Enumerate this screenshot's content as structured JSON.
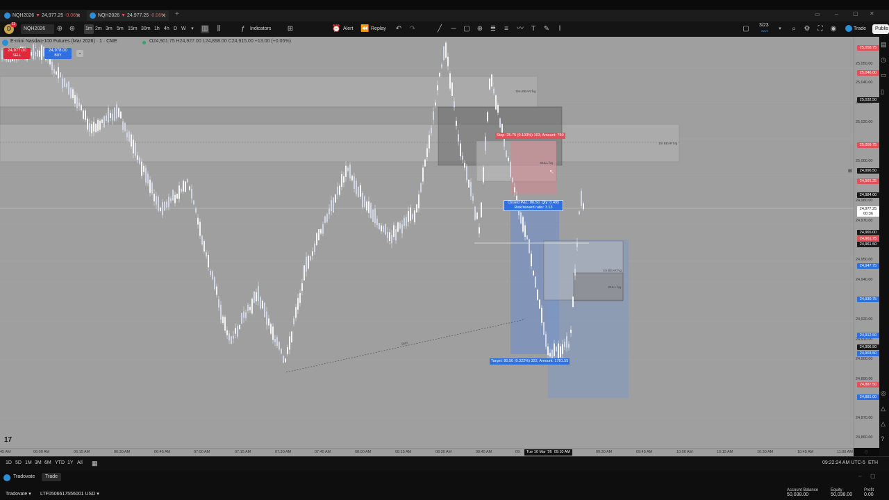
{
  "tabs": [
    {
      "symbol": "NQH2026",
      "direction": "▼",
      "price": "24,977.25",
      "change": "-0.06%"
    },
    {
      "symbol": "NQH2026",
      "direction": "▼",
      "price": "24,977.25",
      "change": "-0.06%"
    }
  ],
  "toolbar": {
    "symbol": "NQH2026",
    "intervals": [
      "1m",
      "2m",
      "3m",
      "5m",
      "15m",
      "30m",
      "1h",
      "4h",
      "D",
      "W"
    ],
    "active_interval": "1m",
    "indicators": "Indicators",
    "alert": "Alert",
    "replay": "Replay",
    "layout_count": "3/23",
    "layout_sub": "Save",
    "trade": "Trade",
    "publish": "Publis",
    "avatar_letter": "D",
    "badge": "11"
  },
  "legend": {
    "title": "E-mini Nasdaq-100 Futures (Mar 2026) · 1 · CME",
    "ohlc": "O24,901.75  H24,927.00  L24,898.00  C24,915.00  +13.00 (+0.05%)",
    "sell_price": "24,977.00",
    "sell_label": "SELL",
    "spread": "1",
    "buy_price": "24,978.00",
    "buy_label": "BUY"
  },
  "annotations": {
    "stop": "Stop: 25.75 (0.103%) 103, Amount: 750",
    "closed_pnl": "Closed P&L: 80.50, Qty: 0.495",
    "rr": "Risk/reward ratio: 3.13",
    "target": "Target: 80.50 (0.322%) 322, Amount: 1781.55",
    "zone1": "15m BEAR fvg",
    "zone2": "1hr BEAR fvg",
    "zone3": "BULL fvg",
    "zone4": "1m BEAR fvg",
    "zone5": "BULL fvg",
    "ssl": "SMT"
  },
  "price_axis": {
    "labels": [
      "25,050.00",
      "25,040.00",
      "25,030.00",
      "25,020.00",
      "25,000.00",
      "24,980.00",
      "24,970.00",
      "24,950.00",
      "24,940.00",
      "24,920.00",
      "24,910.00",
      "24,900.00",
      "24,890.00",
      "24,870.00",
      "24,860.00"
    ],
    "tags": [
      {
        "text": "25,058.75",
        "color": "#e0525a"
      },
      {
        "text": "25,046.00",
        "color": "#e0525a"
      },
      {
        "text": "25,032.50",
        "color": "#1a1a1a"
      },
      {
        "text": "25,009.75",
        "color": "#e0525a"
      },
      {
        "text": "24,996.50",
        "color": "#1a1a1a"
      },
      {
        "text": "24,991.25",
        "color": "#e0525a"
      },
      {
        "text": "24,984.00",
        "color": "#1a1a1a"
      },
      {
        "text": "24,977.25",
        "color": "#ffffff"
      },
      {
        "text": "00:36",
        "color": "#ffffff"
      },
      {
        "text": "24,965.00",
        "color": "#1a1a1a"
      },
      {
        "text": "24,961.75",
        "color": "#e0525a"
      },
      {
        "text": "24,961.50",
        "color": "#1a1a1a"
      },
      {
        "text": "24,947.75",
        "color": "#2f6fe0"
      },
      {
        "text": "24,930.75",
        "color": "#2f6fe0"
      },
      {
        "text": "24,912.50",
        "color": "#2f6fe0"
      },
      {
        "text": "24,906.50",
        "color": "#1a1a1a"
      },
      {
        "text": "24,903.50",
        "color": "#2f6fe0"
      },
      {
        "text": "24,887.50",
        "color": "#e0525a"
      },
      {
        "text": "24,881.00",
        "color": "#2f6fe0"
      }
    ]
  },
  "time_axis": {
    "labels": [
      "45 AM",
      "06:00 AM",
      "06:15 AM",
      "06:30 AM",
      "06:45 AM",
      "07:00 AM",
      "07:15 AM",
      "07:30 AM",
      "07:45 AM",
      "08:00 AM",
      "08:15 AM",
      "08:30 AM",
      "08:45 AM",
      "09:",
      "09:30 AM",
      "09:45 AM",
      "10:00 AM",
      "10:15 AM",
      "10:30 AM",
      "10:45 AM",
      "11:00 AM"
    ],
    "cursor_date": "Tue 10 Mar '26",
    "cursor_time": "09:10 AM"
  },
  "bottombar": {
    "ranges": [
      "1D",
      "5D",
      "1M",
      "3M",
      "6M",
      "YTD",
      "1Y",
      "All"
    ],
    "clock": "09:22:24 AM UTC-5",
    "session": "ETH"
  },
  "tradepanel": {
    "broker": "Tradovate",
    "tab": "Trade",
    "account_broker": "Tradovate",
    "account_id": "LTF0506617556001 USD",
    "balance_label": "Account Balance",
    "balance": "50,038.00",
    "equity_label": "Equity",
    "equity": "50,038.00",
    "profit_label": "Profit",
    "profit": "0.00"
  },
  "colors": {
    "bg_chart": "#9f9f9f",
    "sell": "#e0283a",
    "buy": "#2f6fe0",
    "stop_zone": "#d4878f",
    "target_zone": "#6f8fc9"
  }
}
